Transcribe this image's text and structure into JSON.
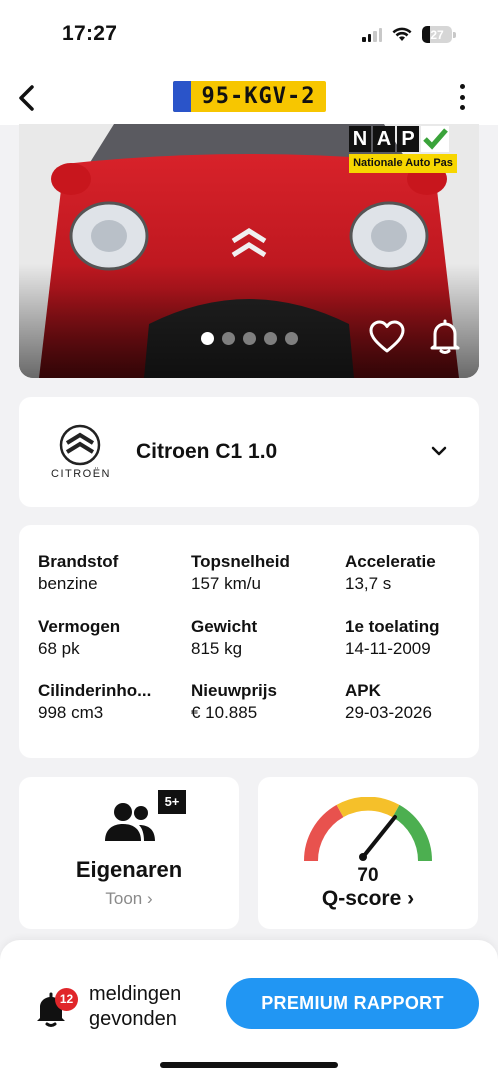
{
  "status_bar": {
    "time": "17:27",
    "battery": "27"
  },
  "nav": {
    "plate": "95-KGV-2"
  },
  "photo": {
    "nap_letters": [
      "N",
      "A",
      "P"
    ],
    "nap_label": "Nationale Auto Pas",
    "slides_total": 5,
    "active_slide": 1
  },
  "brand": {
    "logo_text": "CITROËN",
    "model": "Citroen C1 1.0"
  },
  "specs": [
    {
      "label": "Brandstof",
      "value": "benzine"
    },
    {
      "label": "Topsnelheid",
      "value": "157 km/u"
    },
    {
      "label": "Acceleratie",
      "value": "13,7 s"
    },
    {
      "label": "Vermogen",
      "value": "68 pk"
    },
    {
      "label": "Gewicht",
      "value": "815 kg"
    },
    {
      "label": "1e toelating",
      "value": "14-11-2009"
    },
    {
      "label": "Cilinderinho...",
      "value": "998 cm3"
    },
    {
      "label": "Nieuwprijs",
      "value": "€ 10.885"
    },
    {
      "label": "APK",
      "value": "29-03-2026"
    }
  ],
  "owners": {
    "badge": "5+",
    "title": "Eigenaren",
    "link": "Toon ›"
  },
  "qscore": {
    "value": "70",
    "label": "Q-score ›",
    "gauge_colors": [
      "#e8524e",
      "#f5c02a",
      "#4caf50"
    ]
  },
  "notifications": {
    "count": "12",
    "text": "meldingen gevonden"
  },
  "premium_button": "PREMIUM RAPPORT",
  "colors": {
    "accent": "#2196f3",
    "plate_yellow": "#f7c600",
    "badge_red": "#e0262a"
  }
}
